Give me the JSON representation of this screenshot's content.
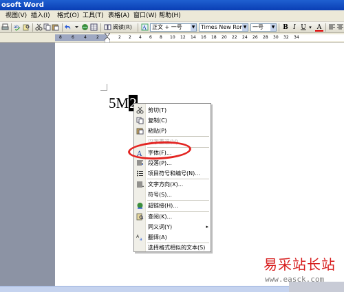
{
  "window": {
    "title": "osoft Word"
  },
  "menubar": {
    "items": [
      "视图(V)",
      "插入(I)",
      "格式(O)",
      "工具(T)",
      "表格(A)",
      "窗口(W)",
      "帮助(H)"
    ]
  },
  "toolbar": {
    "read_label": "阅读(R)",
    "style": "正文 + 一号",
    "font": "Times New Roman",
    "size": "一号",
    "bold": "B",
    "italic": "I",
    "underline": "U",
    "font_color": "A"
  },
  "ruler": {
    "numbers": [
      "8",
      "6",
      "4",
      "2",
      "2",
      "2",
      "4",
      "6",
      "8",
      "10",
      "12",
      "14",
      "16",
      "18",
      "20",
      "22",
      "24",
      "26",
      "28",
      "30",
      "32",
      "34"
    ]
  },
  "document": {
    "text_before": "5M",
    "selected": "2"
  },
  "context_menu": {
    "items": [
      {
        "label": "剪切(T)",
        "icon": "scissors-icon",
        "enabled": true
      },
      {
        "label": "复制(C)",
        "icon": "copy-icon",
        "enabled": true
      },
      {
        "label": "粘贴(P)",
        "icon": "paste-icon",
        "enabled": true
      },
      {
        "label": "汉字重选(V)",
        "icon": "",
        "enabled": false
      },
      {
        "label": "字体(F)...",
        "icon": "font-icon",
        "enabled": true
      },
      {
        "label": "段落(P)...",
        "icon": "paragraph-icon",
        "enabled": true
      },
      {
        "label": "项目符号和编号(N)...",
        "icon": "bullets-icon",
        "enabled": true
      },
      {
        "label": "文字方向(X)...",
        "icon": "text-direction-icon",
        "enabled": true
      },
      {
        "label": "符号(S)...",
        "icon": "",
        "enabled": true
      },
      {
        "label": "超链接(H)...",
        "icon": "hyperlink-icon",
        "enabled": true
      },
      {
        "label": "查阅(K)...",
        "icon": "lookup-icon",
        "enabled": true
      },
      {
        "label": "同义词(Y)",
        "icon": "",
        "enabled": true,
        "submenu": "▸"
      },
      {
        "label": "翻译(A)",
        "icon": "translate-icon",
        "enabled": true
      },
      {
        "label": "选择格式相似的文本(S)",
        "icon": "",
        "enabled": true
      }
    ]
  },
  "watermark": {
    "title": "易采站长站",
    "url": "www.easck.com"
  },
  "colors": {
    "highlight_circle": "#e32421",
    "watermark": "#d71c1c",
    "titlebar": "#0a3fb5"
  }
}
